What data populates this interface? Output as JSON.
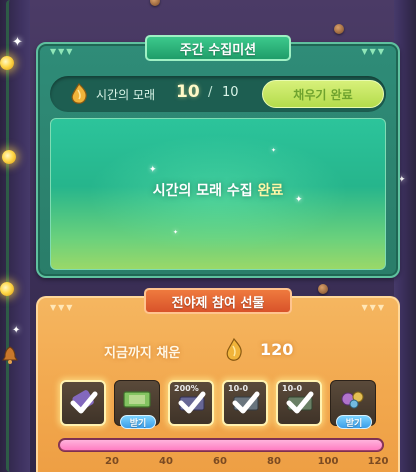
{
  "mission": {
    "title": "주간 수집미션",
    "item_name": "시간의 모래",
    "current": "10",
    "separator": "/",
    "total": "10",
    "fill_button": "채우기 완료",
    "status_prefix": "시간의 모래 수집 ",
    "status_highlight": "완료"
  },
  "reward": {
    "title": "전야제 참여 선물",
    "accum_label": "지금까지 채운",
    "accum_value": "120",
    "progress_fraction": 1.0,
    "slots": [
      {
        "state": "claimed",
        "icon": "scroll-item-icon"
      },
      {
        "state": "claimable",
        "icon": "ticket-item-icon",
        "button": "받기"
      },
      {
        "state": "claimed",
        "icon": "coupon-item-icon",
        "tag": "200%"
      },
      {
        "state": "claimed",
        "icon": "coupon-item-icon",
        "tag": "10-0"
      },
      {
        "state": "claimed",
        "icon": "coupon-item-icon",
        "tag": "10-0"
      },
      {
        "state": "claimable",
        "icon": "potion-bundle-icon",
        "button": "받기"
      }
    ],
    "ticks": [
      "20",
      "40",
      "60",
      "80",
      "100",
      "120"
    ]
  },
  "colors": {
    "mission_green": "#2f8c78",
    "reward_orange": "#f2a84e",
    "track_pink": "#ff7ec2",
    "claim_blue": "#3c9ee8"
  }
}
